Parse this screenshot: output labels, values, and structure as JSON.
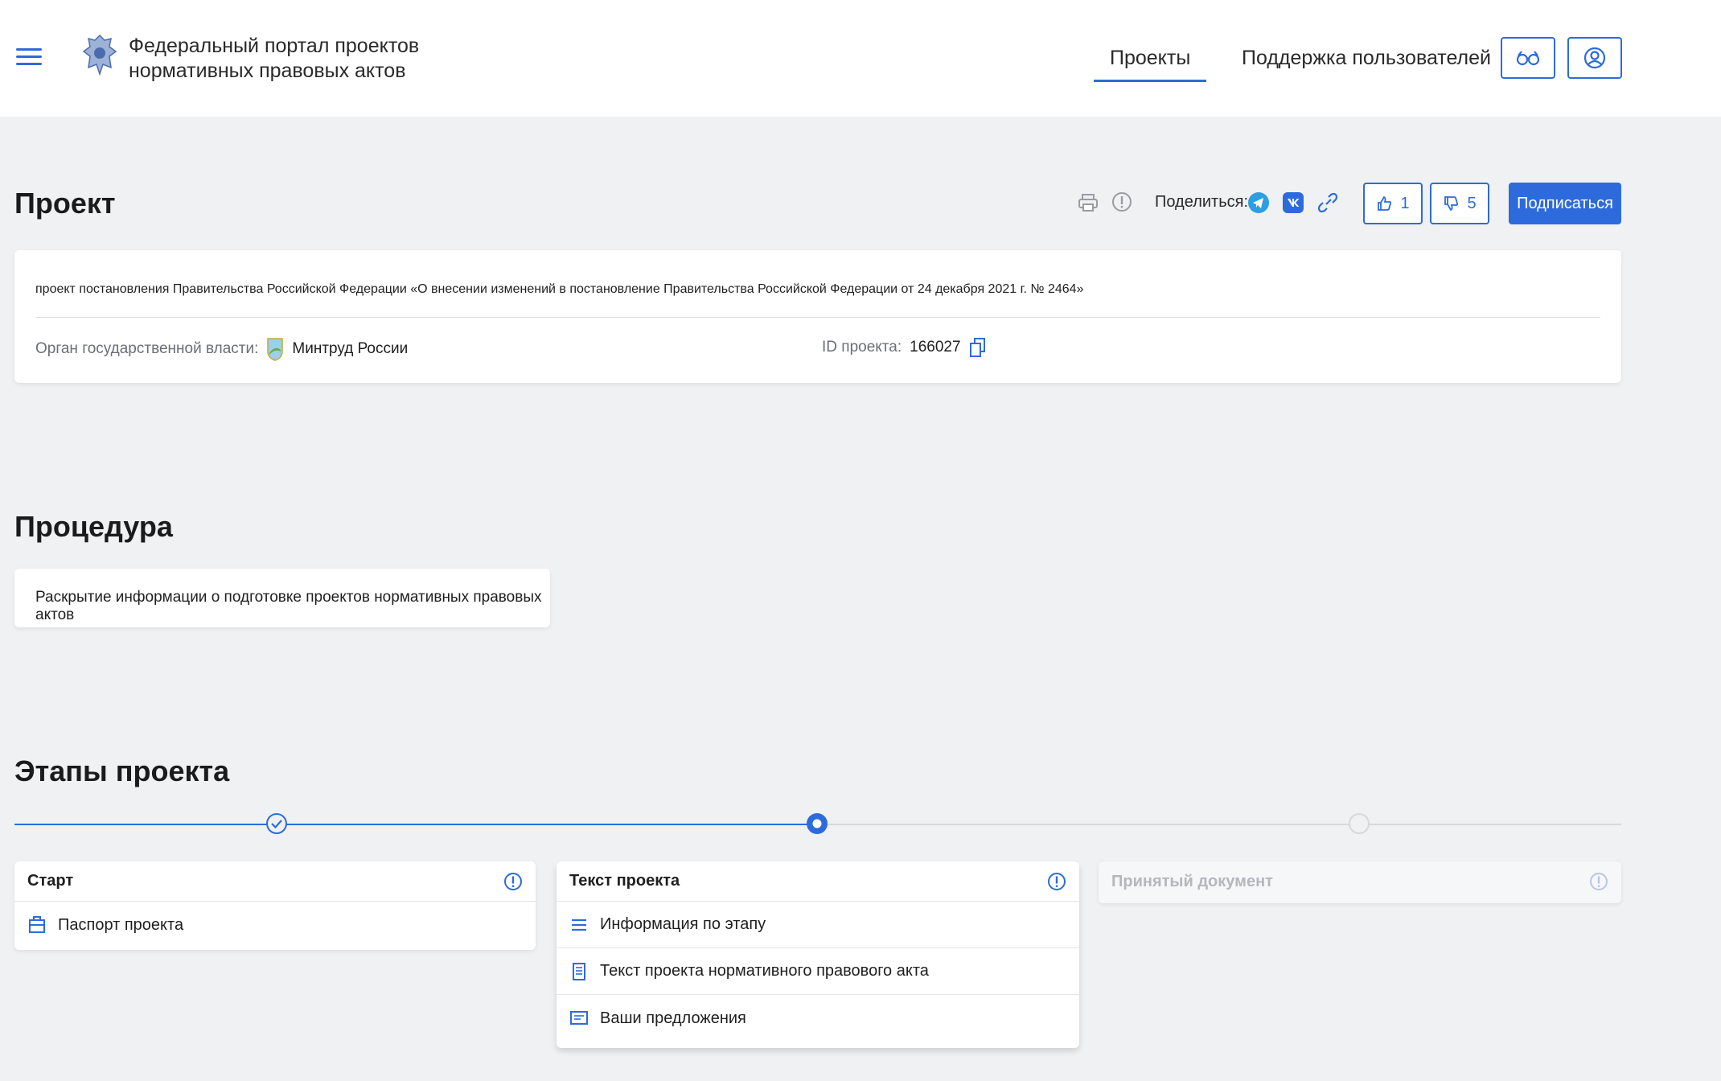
{
  "header": {
    "portal_title_line1": "Федеральный портал проектов",
    "portal_title_line2": "нормативных правовых актов",
    "nav_projects": "Проекты",
    "nav_support": "Поддержка пользователей",
    "accent_color": "#2d6bdc"
  },
  "project": {
    "title": "Проект",
    "share_label": "Поделиться:",
    "likes": "1",
    "dislikes": "5",
    "subscribe_label": "Подписаться",
    "description": "проект постановления Правительства Российской Федерации «О внесении изменений в постановление Правительства Российской Федерации от 24 декабря 2021 г. № 2464»",
    "authority_label": "Орган государственной власти:",
    "authority_value": "Минтруд России",
    "id_label": "ID проекта:",
    "id_value": "166027"
  },
  "procedure": {
    "title": "Процедура",
    "text": "Раскрытие информации о подготовке проектов нормативных правовых актов"
  },
  "stages": {
    "title": "Этапы проекта",
    "items": [
      {
        "name": "Старт",
        "state": "completed",
        "rows": [
          {
            "icon": "briefcase-icon",
            "label": "Паспорт проекта"
          }
        ]
      },
      {
        "name": "Текст проекта",
        "state": "current",
        "rows": [
          {
            "icon": "list-icon",
            "label": "Информация по этапу"
          },
          {
            "icon": "document-icon",
            "label": "Текст проекта нормативного правового акта"
          },
          {
            "icon": "comment-icon",
            "label": "Ваши предложения"
          }
        ]
      },
      {
        "name": "Принятый документ",
        "state": "upcoming",
        "rows": []
      }
    ]
  }
}
